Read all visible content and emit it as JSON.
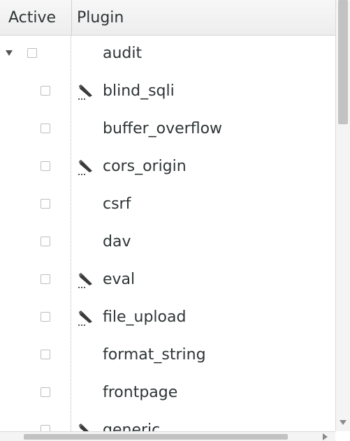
{
  "header": {
    "active_label": "Active",
    "plugin_label": "Plugin"
  },
  "rows": [
    {
      "label": "audit",
      "parent": true,
      "expanded": true,
      "checked": false,
      "editable": false
    },
    {
      "label": "blind_sqli",
      "checked": false,
      "editable": true
    },
    {
      "label": "buffer_overflow",
      "checked": false,
      "editable": false
    },
    {
      "label": "cors_origin",
      "checked": false,
      "editable": true
    },
    {
      "label": "csrf",
      "checked": false,
      "editable": false
    },
    {
      "label": "dav",
      "checked": false,
      "editable": false
    },
    {
      "label": "eval",
      "checked": false,
      "editable": true
    },
    {
      "label": "file_upload",
      "checked": false,
      "editable": true
    },
    {
      "label": "format_string",
      "checked": false,
      "editable": false
    },
    {
      "label": "frontpage",
      "checked": false,
      "editable": false
    },
    {
      "label": "generic",
      "checked": false,
      "editable": true
    }
  ],
  "icons": {
    "expander": "triangle-down-icon",
    "edit": "pencil-edit-icon"
  },
  "colors": {
    "text": "#2e3436",
    "header_bg": "#ededed",
    "scroll_thumb": "#c2c2c2"
  }
}
